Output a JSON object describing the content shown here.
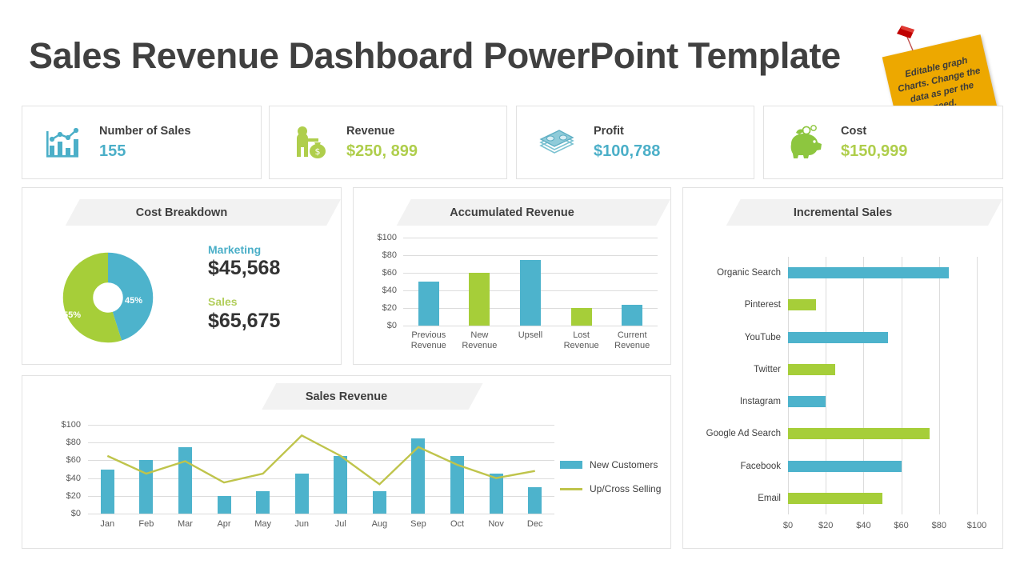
{
  "title": "Sales Revenue Dashboard PowerPoint Template",
  "sticky_note": {
    "text": "Editable graph Charts. Change the data as per the need.",
    "color": "#EDA800",
    "pin_color": "#C00000"
  },
  "colors": {
    "blue": "#4DB3CC",
    "green": "#A6CE39",
    "text_dark": "#404040",
    "border": "#E2E2E2",
    "banner": "#F2F2F2"
  },
  "kpis": [
    {
      "icon": "bar-chart-line-icon",
      "label": "Number of Sales",
      "value": "155",
      "value_color": "#4BAFC8",
      "icon_color": "#4BAFC8"
    },
    {
      "icon": "businessman-money-bag-icon",
      "label": "Revenue",
      "value": "$250, 899",
      "value_color": "#AFCE4C",
      "icon_color": "#AFCE4C"
    },
    {
      "icon": "cash-stack-icon",
      "label": "Profit",
      "value": "$100,788",
      "value_color": "#4BAFC8",
      "icon_color": "#7CC3D2"
    },
    {
      "icon": "piggy-bank-icon",
      "label": "Cost",
      "value": "$150,999",
      "value_color": "#AFCE4C",
      "icon_color": "#8DC63F"
    }
  ],
  "panels": {
    "cost_breakdown": {
      "title": "Cost Breakdown"
    },
    "accumulated_revenue": {
      "title": "Accumulated Revenue"
    },
    "incremental_sales": {
      "title": "Incremental Sales"
    },
    "sales_revenue": {
      "title": "Sales Revenue"
    }
  },
  "chart_data": [
    {
      "id": "cost-breakdown",
      "type": "pie",
      "title": "Cost Breakdown",
      "donut": true,
      "slices": [
        {
          "label": "Marketing",
          "percent": 45,
          "percent_label": "45%",
          "amount": "$45,568",
          "color": "#4DB3CC"
        },
        {
          "label": "Sales",
          "percent": 55,
          "percent_label": "55%",
          "amount": "$65,675",
          "color": "#A6CE39"
        }
      ],
      "legend_position": "right"
    },
    {
      "id": "accumulated-revenue",
      "type": "bar",
      "title": "Accumulated Revenue",
      "categories": [
        "Previous Revenue",
        "New Revenue",
        "Upsell",
        "Lost Revenue",
        "Current Revenue"
      ],
      "values": [
        50,
        60,
        75,
        20,
        24
      ],
      "bar_colors": [
        "#4DB3CC",
        "#A6CE39",
        "#4DB3CC",
        "#A6CE39",
        "#4DB3CC"
      ],
      "ylim": [
        0,
        100
      ],
      "yticks": [
        0,
        20,
        40,
        60,
        80,
        100
      ],
      "ytick_labels": [
        "$0",
        "$20",
        "$40",
        "$60",
        "$80",
        "$100"
      ],
      "xlabel": "",
      "ylabel": "",
      "grid": true
    },
    {
      "id": "incremental-sales",
      "type": "bar",
      "orientation": "horizontal",
      "title": "Incremental Sales",
      "categories": [
        "Organic Search",
        "Pinterest",
        "YouTube",
        "Twitter",
        "Instagram",
        "Google Ad Search",
        "Facebook",
        "Email"
      ],
      "values": [
        85,
        15,
        53,
        25,
        20,
        75,
        60,
        50
      ],
      "bar_colors": [
        "#4DB3CC",
        "#A6CE39",
        "#4DB3CC",
        "#A6CE39",
        "#4DB3CC",
        "#A6CE39",
        "#4DB3CC",
        "#A6CE39"
      ],
      "xlim": [
        0,
        100
      ],
      "xticks": [
        0,
        20,
        40,
        60,
        80,
        100
      ],
      "xtick_labels": [
        "$0",
        "$20",
        "$40",
        "$60",
        "$80",
        "$100"
      ],
      "grid": true
    },
    {
      "id": "sales-revenue",
      "type": "bar",
      "combo": true,
      "title": "Sales Revenue",
      "categories": [
        "Jan",
        "Feb",
        "Mar",
        "Apr",
        "May",
        "Jun",
        "Jul",
        "Aug",
        "Sep",
        "Oct",
        "Nov",
        "Dec"
      ],
      "series": [
        {
          "name": "New Customers",
          "type": "bar",
          "color": "#4DB3CC",
          "values": [
            50,
            60,
            75,
            20,
            25,
            45,
            65,
            25,
            85,
            65,
            45,
            30
          ]
        },
        {
          "name": "Up/Cross Selling",
          "type": "line",
          "color": "#BFC44B",
          "values": [
            65,
            45,
            59,
            35,
            45,
            88,
            65,
            33,
            75,
            55,
            40,
            48
          ]
        }
      ],
      "ylim": [
        0,
        100
      ],
      "yticks": [
        0,
        20,
        40,
        60,
        80,
        100
      ],
      "ytick_labels": [
        "$0",
        "$20",
        "$40",
        "$60",
        "$80",
        "$100"
      ],
      "legend_position": "right",
      "grid": true
    }
  ]
}
